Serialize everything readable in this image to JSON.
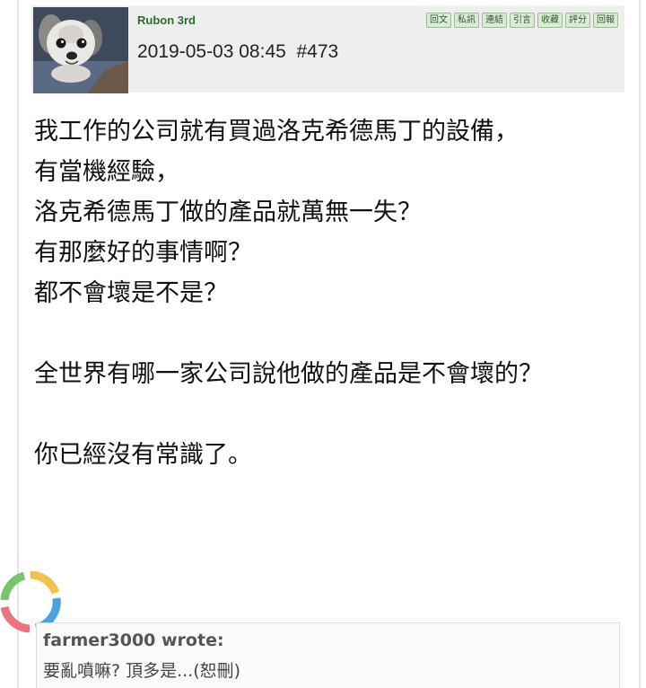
{
  "post": {
    "username": "Rubon 3rd",
    "timestamp": "2019-05-03 08:45",
    "post_number": "#473",
    "actions": [
      "回文",
      "私訊",
      "連結",
      "引言",
      "收藏",
      "評分",
      "回報"
    ],
    "avatar_icon": "dog-avatar"
  },
  "body": {
    "lines": [
      "我工作的公司就有買過洛克希德馬丁的設備，",
      "有當機經驗，",
      "洛克希德馬丁做的產品就萬無一失？",
      "有那麼好的事情啊？",
      "都不會壞是不是？",
      "",
      "全世界有哪一家公司說他做的產品是不會壞的？",
      "",
      "你已經沒有常識了。"
    ]
  },
  "quote": {
    "author": "farmer3000 wrote:",
    "text": "要亂噴嘛? 頂多是...(恕刪)"
  },
  "colors": {
    "header_bg": "#eeeeee",
    "username": "#2f6b2f",
    "action_bg": "#dcebd8",
    "spinner": [
      "#4aa3df",
      "#f2c14e",
      "#e8747c",
      "#7ac46b"
    ]
  }
}
